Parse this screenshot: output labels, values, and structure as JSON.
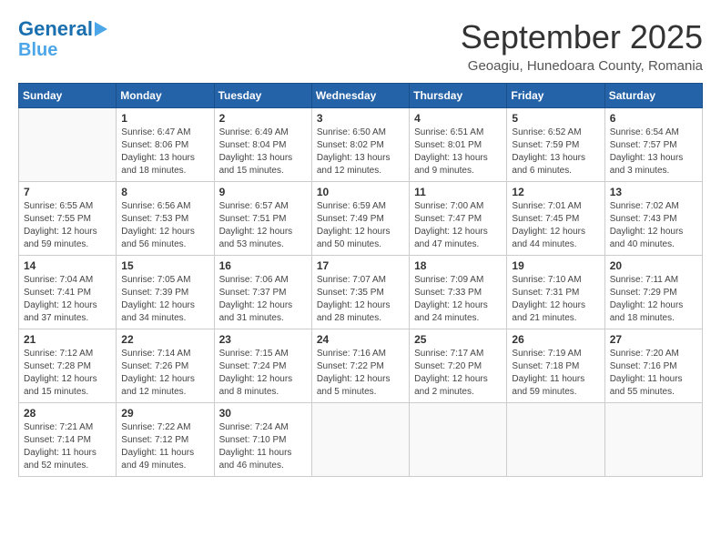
{
  "logo": {
    "line1": "General",
    "line2": "Blue"
  },
  "title": "September 2025",
  "subtitle": "Geoagiu, Hunedoara County, Romania",
  "days_of_week": [
    "Sunday",
    "Monday",
    "Tuesday",
    "Wednesday",
    "Thursday",
    "Friday",
    "Saturday"
  ],
  "weeks": [
    [
      {
        "day": "",
        "info": ""
      },
      {
        "day": "1",
        "info": "Sunrise: 6:47 AM\nSunset: 8:06 PM\nDaylight: 13 hours\nand 18 minutes."
      },
      {
        "day": "2",
        "info": "Sunrise: 6:49 AM\nSunset: 8:04 PM\nDaylight: 13 hours\nand 15 minutes."
      },
      {
        "day": "3",
        "info": "Sunrise: 6:50 AM\nSunset: 8:02 PM\nDaylight: 13 hours\nand 12 minutes."
      },
      {
        "day": "4",
        "info": "Sunrise: 6:51 AM\nSunset: 8:01 PM\nDaylight: 13 hours\nand 9 minutes."
      },
      {
        "day": "5",
        "info": "Sunrise: 6:52 AM\nSunset: 7:59 PM\nDaylight: 13 hours\nand 6 minutes."
      },
      {
        "day": "6",
        "info": "Sunrise: 6:54 AM\nSunset: 7:57 PM\nDaylight: 13 hours\nand 3 minutes."
      }
    ],
    [
      {
        "day": "7",
        "info": "Sunrise: 6:55 AM\nSunset: 7:55 PM\nDaylight: 12 hours\nand 59 minutes."
      },
      {
        "day": "8",
        "info": "Sunrise: 6:56 AM\nSunset: 7:53 PM\nDaylight: 12 hours\nand 56 minutes."
      },
      {
        "day": "9",
        "info": "Sunrise: 6:57 AM\nSunset: 7:51 PM\nDaylight: 12 hours\nand 53 minutes."
      },
      {
        "day": "10",
        "info": "Sunrise: 6:59 AM\nSunset: 7:49 PM\nDaylight: 12 hours\nand 50 minutes."
      },
      {
        "day": "11",
        "info": "Sunrise: 7:00 AM\nSunset: 7:47 PM\nDaylight: 12 hours\nand 47 minutes."
      },
      {
        "day": "12",
        "info": "Sunrise: 7:01 AM\nSunset: 7:45 PM\nDaylight: 12 hours\nand 44 minutes."
      },
      {
        "day": "13",
        "info": "Sunrise: 7:02 AM\nSunset: 7:43 PM\nDaylight: 12 hours\nand 40 minutes."
      }
    ],
    [
      {
        "day": "14",
        "info": "Sunrise: 7:04 AM\nSunset: 7:41 PM\nDaylight: 12 hours\nand 37 minutes."
      },
      {
        "day": "15",
        "info": "Sunrise: 7:05 AM\nSunset: 7:39 PM\nDaylight: 12 hours\nand 34 minutes."
      },
      {
        "day": "16",
        "info": "Sunrise: 7:06 AM\nSunset: 7:37 PM\nDaylight: 12 hours\nand 31 minutes."
      },
      {
        "day": "17",
        "info": "Sunrise: 7:07 AM\nSunset: 7:35 PM\nDaylight: 12 hours\nand 28 minutes."
      },
      {
        "day": "18",
        "info": "Sunrise: 7:09 AM\nSunset: 7:33 PM\nDaylight: 12 hours\nand 24 minutes."
      },
      {
        "day": "19",
        "info": "Sunrise: 7:10 AM\nSunset: 7:31 PM\nDaylight: 12 hours\nand 21 minutes."
      },
      {
        "day": "20",
        "info": "Sunrise: 7:11 AM\nSunset: 7:29 PM\nDaylight: 12 hours\nand 18 minutes."
      }
    ],
    [
      {
        "day": "21",
        "info": "Sunrise: 7:12 AM\nSunset: 7:28 PM\nDaylight: 12 hours\nand 15 minutes."
      },
      {
        "day": "22",
        "info": "Sunrise: 7:14 AM\nSunset: 7:26 PM\nDaylight: 12 hours\nand 12 minutes."
      },
      {
        "day": "23",
        "info": "Sunrise: 7:15 AM\nSunset: 7:24 PM\nDaylight: 12 hours\nand 8 minutes."
      },
      {
        "day": "24",
        "info": "Sunrise: 7:16 AM\nSunset: 7:22 PM\nDaylight: 12 hours\nand 5 minutes."
      },
      {
        "day": "25",
        "info": "Sunrise: 7:17 AM\nSunset: 7:20 PM\nDaylight: 12 hours\nand 2 minutes."
      },
      {
        "day": "26",
        "info": "Sunrise: 7:19 AM\nSunset: 7:18 PM\nDaylight: 11 hours\nand 59 minutes."
      },
      {
        "day": "27",
        "info": "Sunrise: 7:20 AM\nSunset: 7:16 PM\nDaylight: 11 hours\nand 55 minutes."
      }
    ],
    [
      {
        "day": "28",
        "info": "Sunrise: 7:21 AM\nSunset: 7:14 PM\nDaylight: 11 hours\nand 52 minutes."
      },
      {
        "day": "29",
        "info": "Sunrise: 7:22 AM\nSunset: 7:12 PM\nDaylight: 11 hours\nand 49 minutes."
      },
      {
        "day": "30",
        "info": "Sunrise: 7:24 AM\nSunset: 7:10 PM\nDaylight: 11 hours\nand 46 minutes."
      },
      {
        "day": "",
        "info": ""
      },
      {
        "day": "",
        "info": ""
      },
      {
        "day": "",
        "info": ""
      },
      {
        "day": "",
        "info": ""
      }
    ]
  ]
}
